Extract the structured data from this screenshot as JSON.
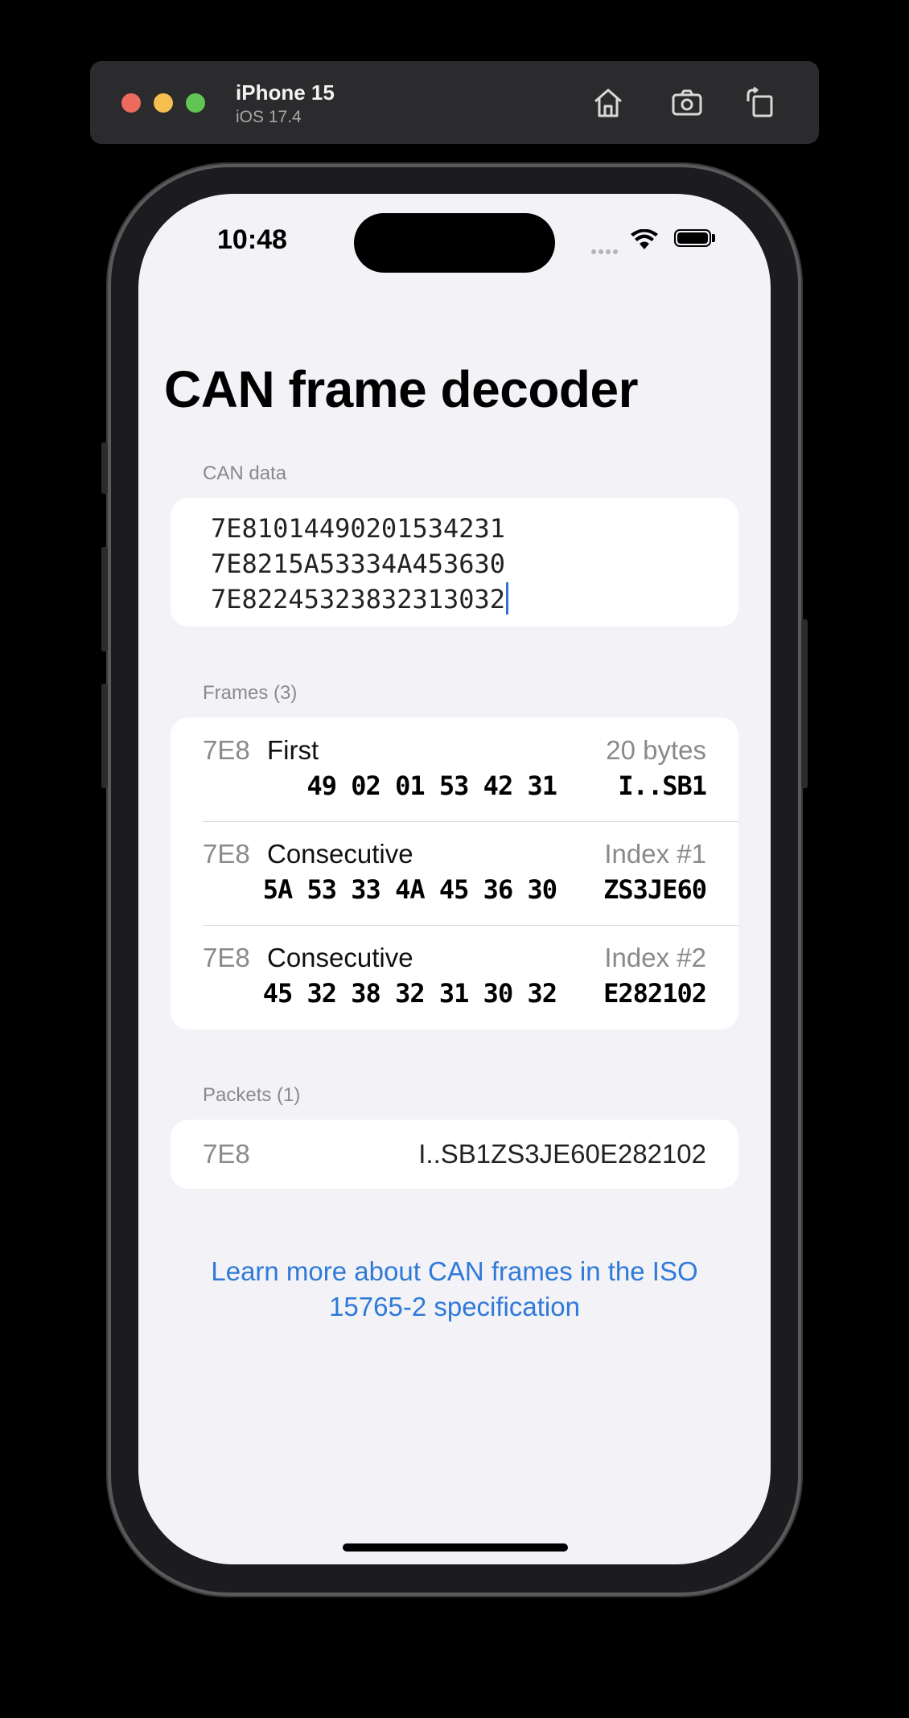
{
  "simulator": {
    "device_name": "iPhone 15",
    "os_version": "iOS 17.4",
    "buttons": [
      "home-icon",
      "screenshot-icon",
      "rotate-icon"
    ]
  },
  "status_bar": {
    "time": "10:48"
  },
  "page": {
    "title": "CAN frame decoder"
  },
  "can_data": {
    "label": "CAN data",
    "lines": [
      "7E81014490201534231",
      "7E8215A53334A453630",
      "7E82245323832313032"
    ]
  },
  "frames": {
    "label": "Frames (3)",
    "items": [
      {
        "id": "7E8",
        "type": "First",
        "meta": "20 bytes",
        "bytes": "49 02 01 53 42 31",
        "ascii": "I..SB1"
      },
      {
        "id": "7E8",
        "type": "Consecutive",
        "meta": "Index #1",
        "bytes": "5A 53 33 4A 45 36 30",
        "ascii": "ZS3JE60"
      },
      {
        "id": "7E8",
        "type": "Consecutive",
        "meta": "Index #2",
        "bytes": "45 32 38 32 31 30 32",
        "ascii": "E282102"
      }
    ]
  },
  "packets": {
    "label": "Packets (1)",
    "items": [
      {
        "id": "7E8",
        "value": "I..SB1ZS3JE60E282102"
      }
    ]
  },
  "learn_more": {
    "text": "Learn more about CAN frames in the ISO 15765-2 specification"
  },
  "colors": {
    "accent": "#2f7ad8",
    "background": "#f2f2f7",
    "secondary_text": "#8a8a8e"
  }
}
